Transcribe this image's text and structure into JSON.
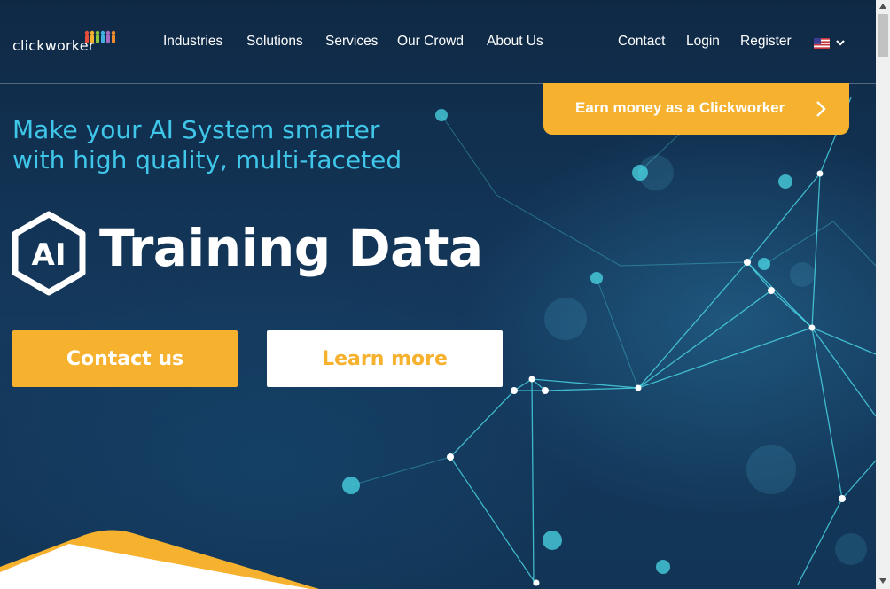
{
  "brand": {
    "logo_text": "clickworker"
  },
  "nav": {
    "industries": "Industries",
    "solutions": "Solutions",
    "services": "Services",
    "our_crowd": "Our Crowd",
    "about_us": "About Us",
    "contact": "Contact",
    "login": "Login",
    "register": "Register",
    "language_icon": "us-flag-icon"
  },
  "earn_banner": {
    "label": "Earn money as a Clickworker",
    "icon": "chevron-right-icon"
  },
  "hero": {
    "headline_line1": "Make your AI System smarter",
    "headline_line2": "with high quality, multi-faceted",
    "badge": "AI",
    "title": "Training Data",
    "contact_button": "Contact us",
    "learn_button": "Learn more"
  },
  "colors": {
    "accent": "#f6b12f",
    "headline": "#3fc6e8",
    "background": "#12304f",
    "network": "#4fe3f0"
  }
}
